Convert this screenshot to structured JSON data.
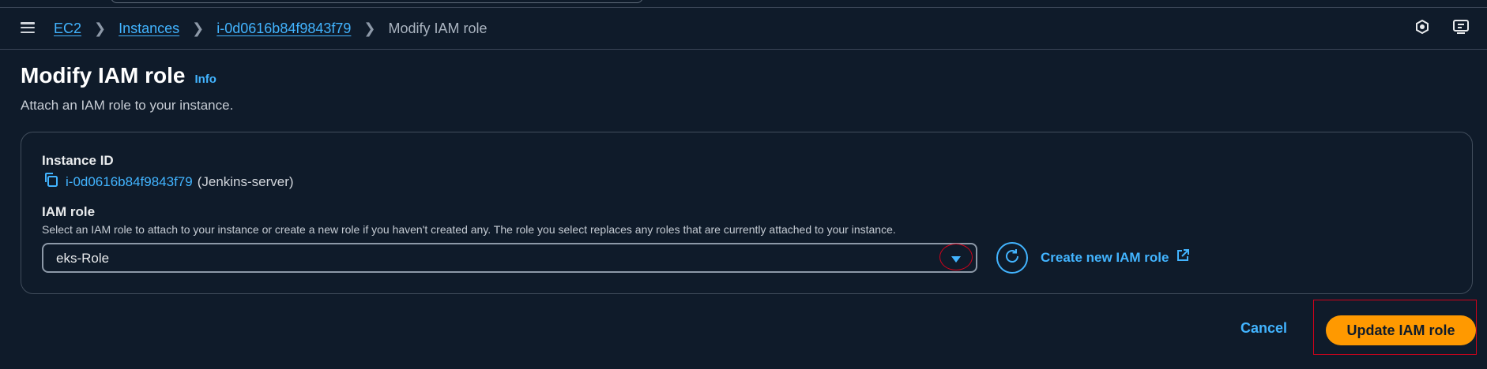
{
  "breadcrumb": {
    "items": [
      "EC2",
      "Instances",
      "i-0d0616b84f9843f79"
    ],
    "current": "Modify IAM role"
  },
  "page": {
    "title": "Modify IAM role",
    "info": "Info",
    "subtitle": "Attach an IAM role to your instance."
  },
  "instance": {
    "label": "Instance ID",
    "id": "i-0d0616b84f9843f79",
    "name": "(Jenkins-server)"
  },
  "iam_role": {
    "label": "IAM role",
    "description": "Select an IAM role to attach to your instance or create a new role if you haven't created any. The role you select replaces any roles that are currently attached to your instance.",
    "selected": "eks-Role",
    "create_label": "Create new IAM role"
  },
  "actions": {
    "cancel": "Cancel",
    "update": "Update IAM role"
  },
  "colors": {
    "background": "#0f1b2a",
    "link": "#42b4ff",
    "primary": "#ff9900",
    "highlight": "#d0021b"
  },
  "icons": [
    "menu-icon",
    "chevron-right-icon",
    "notifications-icon",
    "screen-share-icon",
    "copy-icon",
    "caret-down-icon",
    "refresh-icon",
    "external-link-icon"
  ]
}
